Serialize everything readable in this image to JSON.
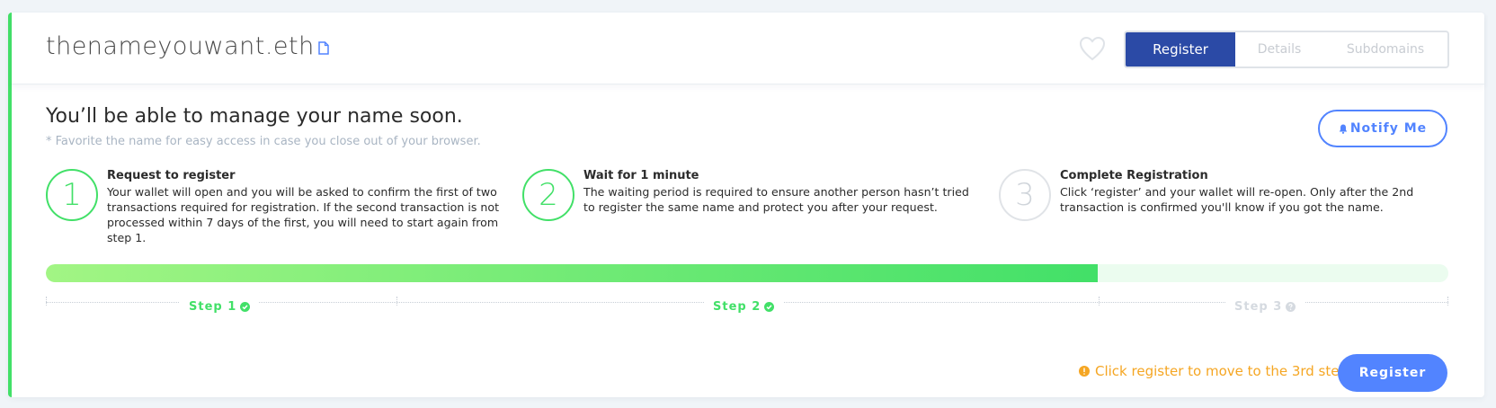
{
  "header": {
    "domain": "thenameyouwant.eth",
    "tabs": [
      {
        "label": "Register",
        "active": true
      },
      {
        "label": "Details",
        "active": false
      },
      {
        "label": "Subdomains",
        "active": false
      }
    ]
  },
  "main": {
    "title": "You’ll be able to manage your name soon.",
    "subtitle": "* Favorite the name for easy access in case you close out of your browser.",
    "notify_label": "Notify Me"
  },
  "steps": [
    {
      "number": "1",
      "title": "Request to register",
      "description": "Your wallet will open and you will be asked to confirm the first of two transactions required for registration. If the second transaction is not processed within 7 days of the first, you will need to start again from step 1.",
      "status": "done"
    },
    {
      "number": "2",
      "title": "Wait for 1 minute",
      "description": "The waiting period is required to ensure another person hasn’t tried to register the same name and protect you after your request.",
      "status": "done"
    },
    {
      "number": "3",
      "title": "Complete Registration",
      "description": "Click ‘register’ and your wallet will re-open. Only after the 2nd transaction is confirmed you'll know if you got the name.",
      "status": "pending"
    }
  ],
  "progress": {
    "fraction": 0.75
  },
  "step_labels": [
    {
      "label": "Step 1",
      "status": "done",
      "icon": "check-circle-icon"
    },
    {
      "label": "Step 2",
      "status": "done",
      "icon": "check-circle-icon"
    },
    {
      "label": "Step 3",
      "status": "pending",
      "icon": "question-circle-icon"
    }
  ],
  "footer": {
    "hint": "Click register to move to the 3rd step",
    "register_label": "Register"
  },
  "colors": {
    "accent_green": "#42e068",
    "primary_blue": "#5284ff",
    "tab_active": "#2b4aa6",
    "warning": "#f5a623"
  }
}
